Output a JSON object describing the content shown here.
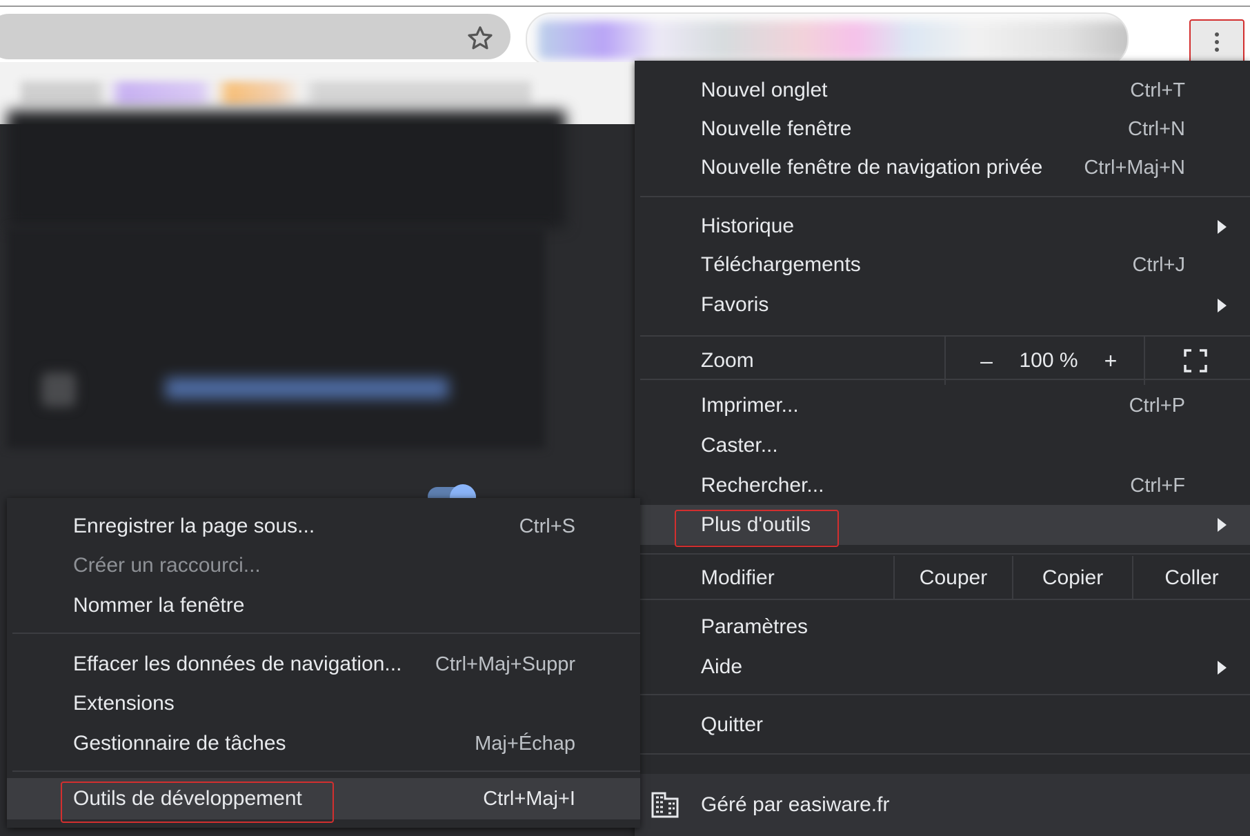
{
  "main_menu": {
    "new_tab": {
      "label": "Nouvel onglet",
      "shortcut": "Ctrl+T"
    },
    "new_window": {
      "label": "Nouvelle fenêtre",
      "shortcut": "Ctrl+N"
    },
    "incognito": {
      "label": "Nouvelle fenêtre de navigation privée",
      "shortcut": "Ctrl+Maj+N"
    },
    "history": {
      "label": "Historique"
    },
    "downloads": {
      "label": "Téléchargements",
      "shortcut": "Ctrl+J"
    },
    "bookmarks": {
      "label": "Favoris"
    },
    "zoom": {
      "label": "Zoom",
      "minus": "–",
      "value": "100 %",
      "plus": "+"
    },
    "print": {
      "label": "Imprimer...",
      "shortcut": "Ctrl+P"
    },
    "cast": {
      "label": "Caster..."
    },
    "find": {
      "label": "Rechercher...",
      "shortcut": "Ctrl+F"
    },
    "more_tools": {
      "label": "Plus d'outils"
    },
    "edit": {
      "label": "Modifier",
      "cut": "Couper",
      "copy": "Copier",
      "paste": "Coller"
    },
    "settings": {
      "label": "Paramètres"
    },
    "help": {
      "label": "Aide"
    },
    "quit": {
      "label": "Quitter"
    },
    "managed": {
      "label": "Géré par easiware.fr"
    }
  },
  "sub_menu": {
    "save_page": {
      "label": "Enregistrer la page sous...",
      "shortcut": "Ctrl+S"
    },
    "create_shortcut": {
      "label": "Créer un raccourci..."
    },
    "name_window": {
      "label": "Nommer la fenêtre"
    },
    "clear_data": {
      "label": "Effacer les données de navigation...",
      "shortcut": "Ctrl+Maj+Suppr"
    },
    "extensions": {
      "label": "Extensions"
    },
    "task_manager": {
      "label": "Gestionnaire de tâches",
      "shortcut": "Maj+Échap"
    },
    "devtools": {
      "label": "Outils de développement",
      "shortcut": "Ctrl+Maj+I"
    }
  },
  "colors": {
    "menu_bg": "#292a2d",
    "highlight_bg": "#3c3d41",
    "annotation_red": "#d32f2f",
    "text": "#e8eaed",
    "shortcut_text": "#bdc1c6"
  }
}
